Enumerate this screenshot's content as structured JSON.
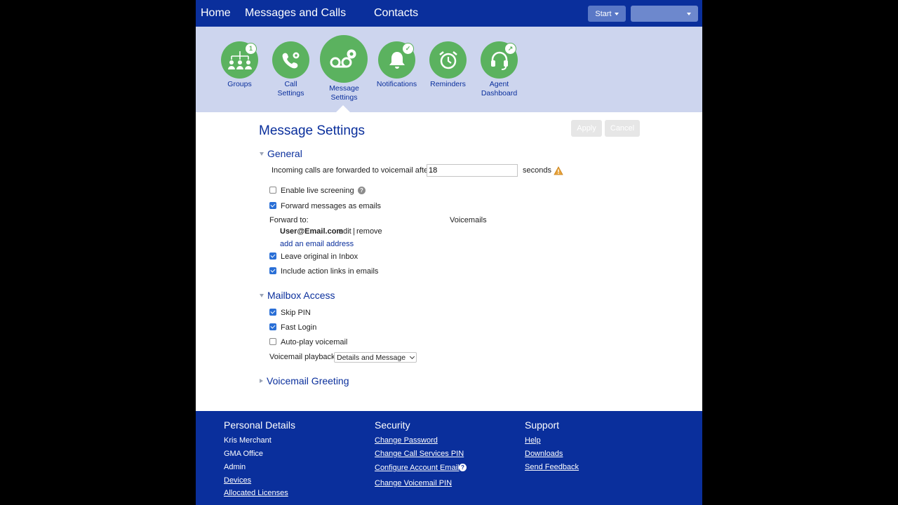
{
  "nav": {
    "home": "Home",
    "messages_calls": "Messages and Calls",
    "contacts": "Contacts",
    "start": "Start",
    "user_menu": ""
  },
  "tiles": [
    {
      "label1": "Groups",
      "label2": "",
      "badge": "1",
      "icon": "groups-icon"
    },
    {
      "label1": "Call",
      "label2": "Settings",
      "badge": "",
      "icon": "call-settings-icon"
    },
    {
      "label1": "Message",
      "label2": "Settings",
      "badge": "",
      "icon": "voicemail-settings-icon"
    },
    {
      "label1": "Notifications",
      "label2": "",
      "badge": "✓",
      "icon": "bell-icon"
    },
    {
      "label1": "Reminders",
      "label2": "",
      "badge": "",
      "icon": "alarm-clock-icon"
    },
    {
      "label1": "Agent",
      "label2": "Dashboard",
      "badge": "↗",
      "icon": "headset-icon"
    }
  ],
  "page": {
    "title": "Message Settings",
    "apply": "Apply",
    "cancel": "Cancel"
  },
  "general": {
    "heading": "General",
    "forward_label": "Incoming calls are forwarded to voicemail after",
    "forward_value": "18",
    "seconds": "seconds",
    "live_screening": "Enable live screening",
    "live_screening_checked": false,
    "forward_emails": "Forward messages as emails",
    "forward_emails_checked": true,
    "forward_to": "Forward to:",
    "voicemails": "Voicemails",
    "email": "User@Email.com",
    "edit": "edit",
    "separator": "|",
    "remove": "remove",
    "add_email": "add an email address",
    "leave_original": "Leave original in Inbox",
    "leave_original_checked": true,
    "action_links": "Include action links in emails",
    "action_links_checked": true
  },
  "mailbox": {
    "heading": "Mailbox Access",
    "skip_pin": "Skip PIN",
    "skip_pin_checked": true,
    "fast_login": "Fast Login",
    "fast_login_checked": true,
    "autoplay": "Auto-play voicemail",
    "autoplay_checked": false,
    "playback_label": "Voicemail playback",
    "playback_value": "Details and Message"
  },
  "greeting": {
    "heading": "Voicemail Greeting"
  },
  "footer": {
    "personal": {
      "title": "Personal Details",
      "name": "Kris Merchant",
      "office": "GMA Office",
      "role": "Admin",
      "devices": "Devices",
      "licenses": "Allocated Licenses"
    },
    "security": {
      "title": "Security",
      "change_password": "Change Password",
      "change_cs_pin": "Change Call Services PIN",
      "configure_email": "Configure Account Email",
      "change_vm_pin": "Change Voicemail PIN"
    },
    "support": {
      "title": "Support",
      "help": "Help",
      "downloads": "Downloads",
      "feedback": "Send Feedback"
    }
  },
  "colors": {
    "primary": "#0a2f9c",
    "icon_bar": "#cdd5ee",
    "tile_green": "#5bb25f",
    "checkbox": "#2a6fd6",
    "warning": "#e8a33a"
  }
}
